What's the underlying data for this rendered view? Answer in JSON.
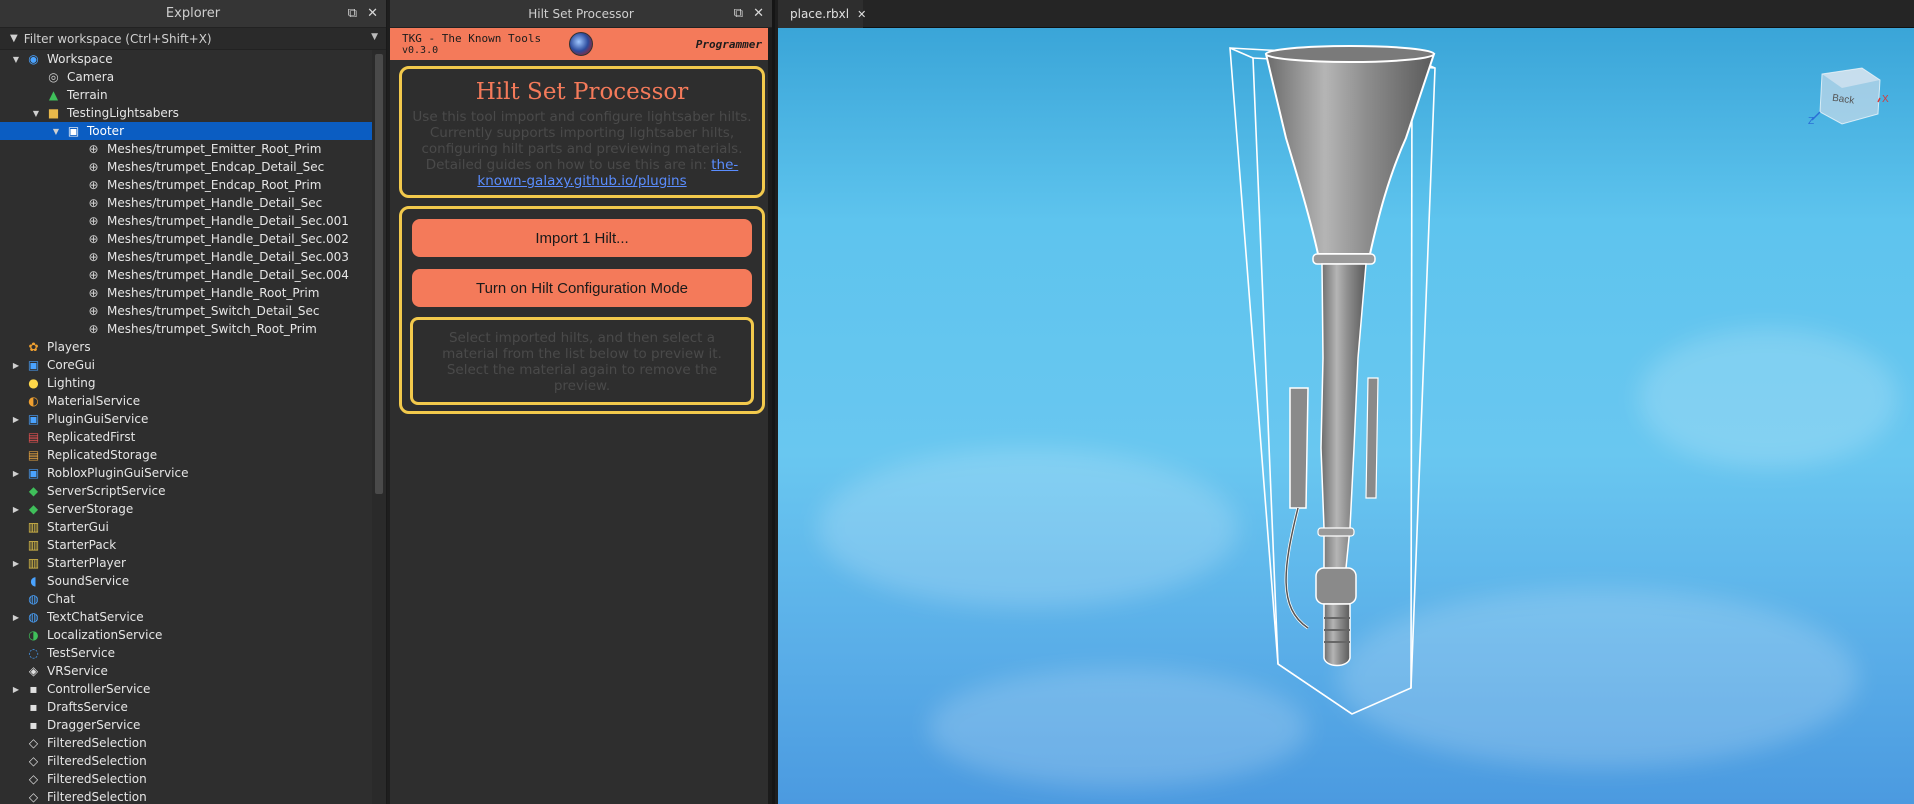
{
  "explorer": {
    "title": "Explorer",
    "filter_placeholder": "Filter workspace (Ctrl+Shift+X)",
    "items": [
      {
        "label": "Workspace",
        "depth": 0,
        "arrow": "down",
        "icon": "workspace-icon",
        "color": "#4aa3ff"
      },
      {
        "label": "Camera",
        "depth": 1,
        "arrow": "",
        "icon": "camera-icon",
        "color": "#d0d0d0"
      },
      {
        "label": "Terrain",
        "depth": 1,
        "arrow": "",
        "icon": "terrain-icon",
        "color": "#3fbf5a"
      },
      {
        "label": "TestingLightsabers",
        "depth": 1,
        "arrow": "down",
        "icon": "folder-icon",
        "color": "#e8b84a"
      },
      {
        "label": "Tooter",
        "depth": 2,
        "arrow": "down",
        "icon": "model-icon",
        "color": "#ffffff",
        "selected": true
      },
      {
        "label": "Meshes/trumpet_Emitter_Root_Prim",
        "depth": 3,
        "arrow": "",
        "icon": "meshpart-icon",
        "color": "#d0d0d0"
      },
      {
        "label": "Meshes/trumpet_Endcap_Detail_Sec",
        "depth": 3,
        "arrow": "",
        "icon": "meshpart-icon",
        "color": "#d0d0d0"
      },
      {
        "label": "Meshes/trumpet_Endcap_Root_Prim",
        "depth": 3,
        "arrow": "",
        "icon": "meshpart-icon",
        "color": "#d0d0d0"
      },
      {
        "label": "Meshes/trumpet_Handle_Detail_Sec",
        "depth": 3,
        "arrow": "",
        "icon": "meshpart-icon",
        "color": "#d0d0d0"
      },
      {
        "label": "Meshes/trumpet_Handle_Detail_Sec.001",
        "depth": 3,
        "arrow": "",
        "icon": "meshpart-icon",
        "color": "#d0d0d0"
      },
      {
        "label": "Meshes/trumpet_Handle_Detail_Sec.002",
        "depth": 3,
        "arrow": "",
        "icon": "meshpart-icon",
        "color": "#d0d0d0"
      },
      {
        "label": "Meshes/trumpet_Handle_Detail_Sec.003",
        "depth": 3,
        "arrow": "",
        "icon": "meshpart-icon",
        "color": "#d0d0d0"
      },
      {
        "label": "Meshes/trumpet_Handle_Detail_Sec.004",
        "depth": 3,
        "arrow": "",
        "icon": "meshpart-icon",
        "color": "#d0d0d0"
      },
      {
        "label": "Meshes/trumpet_Handle_Root_Prim",
        "depth": 3,
        "arrow": "",
        "icon": "meshpart-icon",
        "color": "#d0d0d0"
      },
      {
        "label": "Meshes/trumpet_Switch_Detail_Sec",
        "depth": 3,
        "arrow": "",
        "icon": "meshpart-icon",
        "color": "#d0d0d0"
      },
      {
        "label": "Meshes/trumpet_Switch_Root_Prim",
        "depth": 3,
        "arrow": "",
        "icon": "meshpart-icon",
        "color": "#d0d0d0"
      },
      {
        "label": "Players",
        "depth": 0,
        "arrow": "",
        "icon": "players-icon",
        "color": "#f0a030"
      },
      {
        "label": "CoreGui",
        "depth": 0,
        "arrow": "right",
        "icon": "coregui-icon",
        "color": "#4aa3ff"
      },
      {
        "label": "Lighting",
        "depth": 0,
        "arrow": "",
        "icon": "lightbulb-icon",
        "color": "#ffd84a"
      },
      {
        "label": "MaterialService",
        "depth": 0,
        "arrow": "",
        "icon": "material-icon",
        "color": "#f0a030"
      },
      {
        "label": "PluginGuiService",
        "depth": 0,
        "arrow": "right",
        "icon": "plugingui-icon",
        "color": "#4aa3ff"
      },
      {
        "label": "ReplicatedFirst",
        "depth": 0,
        "arrow": "",
        "icon": "replicatedfirst-icon",
        "color": "#e05050"
      },
      {
        "label": "ReplicatedStorage",
        "depth": 0,
        "arrow": "",
        "icon": "replicatedstorage-icon",
        "color": "#e0a040"
      },
      {
        "label": "RobloxPluginGuiService",
        "depth": 0,
        "arrow": "right",
        "icon": "plugingui-icon",
        "color": "#4aa3ff"
      },
      {
        "label": "ServerScriptService",
        "depth": 0,
        "arrow": "",
        "icon": "serverscript-icon",
        "color": "#3fbf5a"
      },
      {
        "label": "ServerStorage",
        "depth": 0,
        "arrow": "right",
        "icon": "serverstorage-icon",
        "color": "#3fbf5a"
      },
      {
        "label": "StarterGui",
        "depth": 0,
        "arrow": "",
        "icon": "startergui-icon",
        "color": "#e8c84a"
      },
      {
        "label": "StarterPack",
        "depth": 0,
        "arrow": "",
        "icon": "starterpack-icon",
        "color": "#e8c84a"
      },
      {
        "label": "StarterPlayer",
        "depth": 0,
        "arrow": "right",
        "icon": "starterplayer-icon",
        "color": "#e8c84a"
      },
      {
        "label": "SoundService",
        "depth": 0,
        "arrow": "",
        "icon": "sound-icon",
        "color": "#4aa3ff"
      },
      {
        "label": "Chat",
        "depth": 0,
        "arrow": "",
        "icon": "chat-icon",
        "color": "#4aa3ff"
      },
      {
        "label": "TextChatService",
        "depth": 0,
        "arrow": "right",
        "icon": "textchat-icon",
        "color": "#4aa3ff"
      },
      {
        "label": "LocalizationService",
        "depth": 0,
        "arrow": "",
        "icon": "localization-icon",
        "color": "#3fbf5a"
      },
      {
        "label": "TestService",
        "depth": 0,
        "arrow": "",
        "icon": "testservice-icon",
        "color": "#4aa3ff"
      },
      {
        "label": "VRService",
        "depth": 0,
        "arrow": "",
        "icon": "vr-icon",
        "color": "#e0e0e0"
      },
      {
        "label": "ControllerService",
        "depth": 0,
        "arrow": "right",
        "icon": "service-icon",
        "color": "#e0e0e0"
      },
      {
        "label": "DraftsService",
        "depth": 0,
        "arrow": "",
        "icon": "service-icon",
        "color": "#e0e0e0"
      },
      {
        "label": "DraggerService",
        "depth": 0,
        "arrow": "",
        "icon": "service-icon",
        "color": "#e0e0e0"
      },
      {
        "label": "FilteredSelection",
        "depth": 0,
        "arrow": "",
        "icon": "diamond-icon",
        "color": "#e0e0e0"
      },
      {
        "label": "FilteredSelection",
        "depth": 0,
        "arrow": "",
        "icon": "diamond-icon",
        "color": "#e0e0e0"
      },
      {
        "label": "FilteredSelection",
        "depth": 0,
        "arrow": "",
        "icon": "diamond-icon",
        "color": "#e0e0e0"
      },
      {
        "label": "FilteredSelection",
        "depth": 0,
        "arrow": "",
        "icon": "diamond-icon",
        "color": "#e0e0e0"
      }
    ]
  },
  "plugin": {
    "panel_title": "Hilt Set Processor",
    "header_name": "TKG - The Known Tools",
    "header_version": "v0.3.0",
    "header_role": "Programmer",
    "title": "Hilt Set Processor",
    "description": "Use this tool import and configure lightsaber hilts. Currently supports importing lightsaber hilts, configuring hilt parts and previewing materials. Detailed guides on how to use this are in:",
    "link_text": "the-known-galaxy.github.io/plugins",
    "import_button": "Import 1 Hilt...",
    "config_button": "Turn on Hilt Configuration Mode",
    "hint": "Select imported hilts, and then select a material from the list below to preview it. Select the material again to remove the preview."
  },
  "viewport": {
    "tab_label": "place.rbxl",
    "viewcube_label": "Back",
    "axis_z": "Z",
    "axis_x": "X"
  },
  "colors": {
    "accent_orange": "#f47a5a",
    "accent_yellow": "#f2c94c",
    "selection_blue": "#0b5dc2",
    "sky": "#69c7f0"
  }
}
